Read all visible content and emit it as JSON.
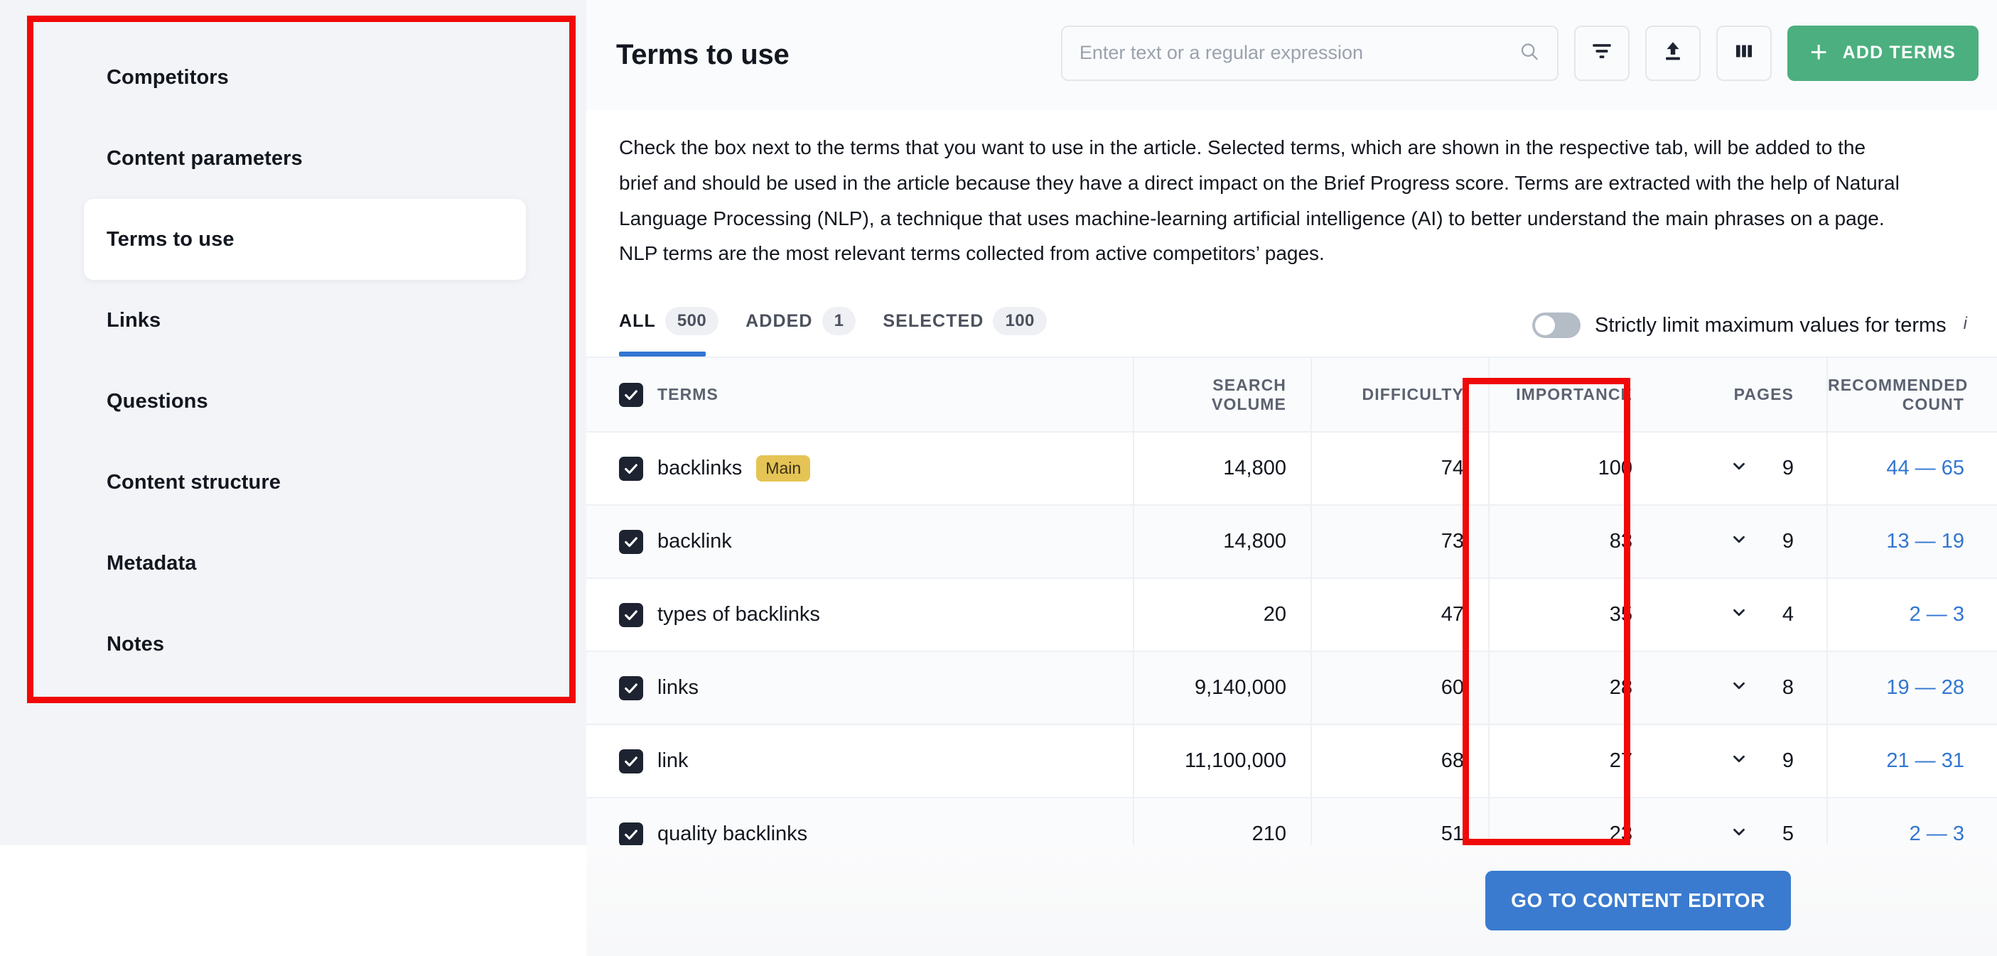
{
  "sidebar": {
    "items": [
      {
        "label": "Competitors",
        "active": false
      },
      {
        "label": "Content parameters",
        "active": false
      },
      {
        "label": "Terms to use",
        "active": true
      },
      {
        "label": "Links",
        "active": false
      },
      {
        "label": "Questions",
        "active": false
      },
      {
        "label": "Content structure",
        "active": false
      },
      {
        "label": "Metadata",
        "active": false
      },
      {
        "label": "Notes",
        "active": false
      }
    ]
  },
  "header": {
    "title": "Terms to use",
    "search": {
      "value": "",
      "placeholder": "Enter text or a regular expression",
      "icon": "search-icon"
    },
    "buttons": [
      {
        "name": "filter-button",
        "icon": "filter-icon"
      },
      {
        "name": "export-button",
        "icon": "upload-icon"
      },
      {
        "name": "columns-button",
        "icon": "columns-icon"
      }
    ],
    "add_terms": {
      "label": "ADD TERMS",
      "icon": "plus-icon",
      "color": "#4caf7f"
    }
  },
  "description": "Check the box next to the terms that you want to use in the article. Selected terms, which are shown in the respective tab, will be added to the brief and should be used in the article because they have a direct impact on the Brief Progress score. Terms are extracted with the help of Natural Language Processing (NLP), a technique that uses machine-learning artificial intelligence (AI) to better understand the main phrases on a page. NLP terms are the most relevant terms collected from active competitors’ pages.",
  "tabs": [
    {
      "label": "ALL",
      "count": "500",
      "active": true
    },
    {
      "label": "ADDED",
      "count": "1",
      "active": false
    },
    {
      "label": "SELECTED",
      "count": "100",
      "active": false
    }
  ],
  "toggle": {
    "label": "Strictly limit maximum values for terms",
    "state": "off",
    "info_icon": "info-icon",
    "info_glyph": "i"
  },
  "table": {
    "columns": [
      {
        "key": "terms",
        "label": "TERMS"
      },
      {
        "key": "search_volume",
        "label": "SEARCH\nVOLUME"
      },
      {
        "key": "difficulty",
        "label": "DIFFICULTY"
      },
      {
        "key": "importance",
        "label": "IMPORTANCE"
      },
      {
        "key": "pages",
        "label": "PAGES"
      },
      {
        "key": "recommended_count",
        "label": "RECOMMENDED\nCOUNT"
      }
    ],
    "header_labels": {
      "terms": "TERMS",
      "search_volume_l1": "SEARCH",
      "search_volume_l2": "VOLUME",
      "difficulty": "DIFFICULTY",
      "importance": "IMPORTANCE",
      "pages": "PAGES",
      "recommended_l1": "RECOMMENDED",
      "recommended_l2": "COUNT"
    },
    "select_all_checked": true,
    "rows": [
      {
        "term": "backlinks",
        "badge": "Main",
        "checked": true,
        "search_volume": "14,800",
        "difficulty": "74",
        "importance": "100",
        "pages": "9",
        "recommended_count": "44 — 65"
      },
      {
        "term": "backlink",
        "badge": "",
        "checked": true,
        "search_volume": "14,800",
        "difficulty": "73",
        "importance": "83",
        "pages": "9",
        "recommended_count": "13 — 19"
      },
      {
        "term": "types of backlinks",
        "badge": "",
        "checked": true,
        "search_volume": "20",
        "difficulty": "47",
        "importance": "35",
        "pages": "4",
        "recommended_count": "2 — 3"
      },
      {
        "term": "links",
        "badge": "",
        "checked": true,
        "search_volume": "9,140,000",
        "difficulty": "60",
        "importance": "28",
        "pages": "8",
        "recommended_count": "19 — 28"
      },
      {
        "term": "link",
        "badge": "",
        "checked": true,
        "search_volume": "11,100,000",
        "difficulty": "68",
        "importance": "27",
        "pages": "9",
        "recommended_count": "21 — 31"
      },
      {
        "term": "quality backlinks",
        "badge": "",
        "checked": true,
        "search_volume": "210",
        "difficulty": "51",
        "importance": "23",
        "pages": "5",
        "recommended_count": "2 — 3"
      }
    ]
  },
  "footer": {
    "primary_button": {
      "label": "GO TO CONTENT EDITOR",
      "color": "#3a7bd0"
    }
  },
  "annotations": [
    {
      "name": "sidebar-highlight",
      "color": "#f10808"
    },
    {
      "name": "importance-column-highlight",
      "color": "#f10808"
    }
  ]
}
